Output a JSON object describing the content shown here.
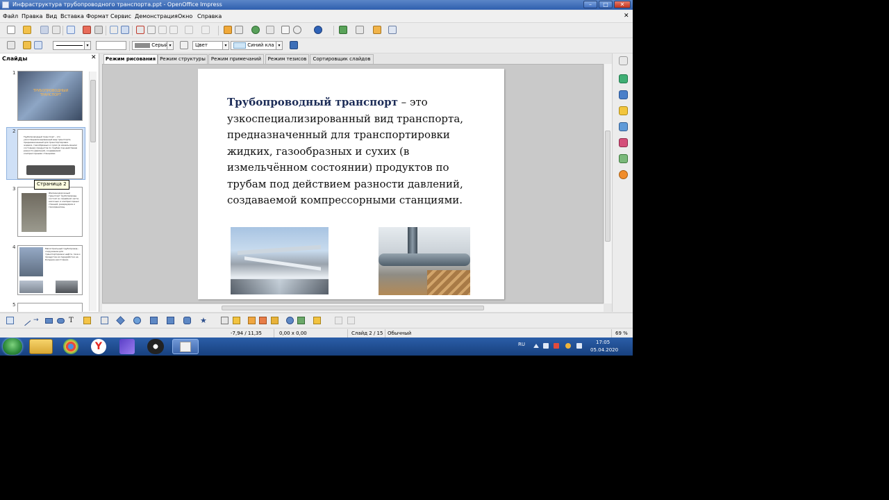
{
  "window": {
    "title": "Инфраструктура трубопроводного транспорта.ppt - OpenOffice Impress",
    "minimize": "–",
    "maximize": "□",
    "close": "✕"
  },
  "menu": {
    "items": [
      "Файл",
      "Правка",
      "Вид",
      "Вставка",
      "Формат",
      "Сервис",
      "Демонстрация",
      "Окно",
      "Справка"
    ],
    "doc_close": "✕"
  },
  "toolbar2": {
    "area_color_style": "Серый",
    "line_color_mode": "Цвет",
    "color_name": "Синий кла"
  },
  "slides_panel": {
    "title": "Слайды",
    "close": "✕",
    "thumbnails": [
      {
        "number": "1",
        "caption": "ТРУБОПРОВОДНЫЙ ТРАНСПОРТ"
      },
      {
        "number": "2",
        "caption": "Трубопроводный транспорт – это узкоспециализированный вид транспорта, предназначенный для транспортировки жидких, газообразных и сухих (в измельчённом состоянии) продуктов по трубам под действием разности давлений, создаваемой компрессорными станциями."
      },
      {
        "number": "3",
        "caption": "Железнодорожный транспорт трубопроводы состоят из линейной части, насосных и компрессорных станций, резервуаров и газохранилищ."
      },
      {
        "number": "4",
        "caption": "Магистральный трубопровод – сооружение для транспортировки нефти, газа и продуктов их переработки на большие расстояния."
      },
      {
        "number": "5",
        "caption": ""
      }
    ],
    "tooltip": "Страница 2"
  },
  "tabs": [
    {
      "label": "Режим рисования",
      "active": true
    },
    {
      "label": "Режим структуры",
      "active": false
    },
    {
      "label": "Режим примечаний",
      "active": false
    },
    {
      "label": "Режим тезисов",
      "active": false
    },
    {
      "label": "Сортировщик слайдов",
      "active": false
    }
  ],
  "slide": {
    "term": "Трубопроводный транспорт",
    "body": " – это узкоспециализированный вид транспорта, предназначенный для транспортировки жидких, газообразных и сухих (в измельчённом состоянии) продуктов по трубам под действием разности давлений, создаваемой компрессорными станциями."
  },
  "statusbar": {
    "position": "-7,94 / 11,35",
    "size": "0,00 x 0,00",
    "slide_info": "Слайд 2 / 15",
    "layout": "Обычный",
    "zoom": "69 %"
  },
  "taskbar": {
    "lang": "RU",
    "time": "17:05",
    "date": "05.04.2020"
  },
  "colors": {
    "titlebar": "#3a68b4",
    "slide_term": "#1c2c57",
    "taskbar": "#1f4b8e"
  }
}
